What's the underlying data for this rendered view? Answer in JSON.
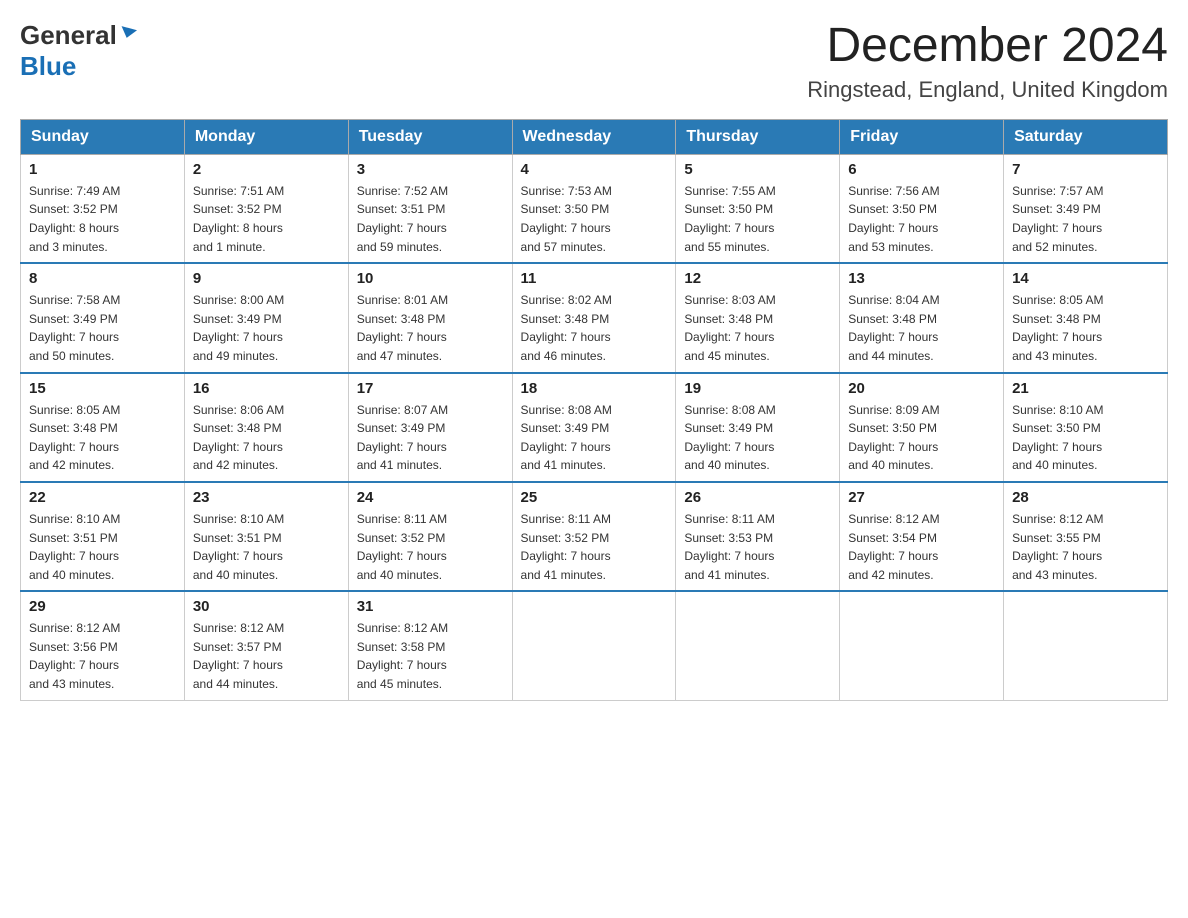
{
  "header": {
    "logo_general": "General",
    "logo_blue": "Blue",
    "month_title": "December 2024",
    "location": "Ringstead, England, United Kingdom"
  },
  "weekdays": [
    "Sunday",
    "Monday",
    "Tuesday",
    "Wednesday",
    "Thursday",
    "Friday",
    "Saturday"
  ],
  "weeks": [
    [
      {
        "day": "1",
        "sunrise": "7:49 AM",
        "sunset": "3:52 PM",
        "daylight": "8 hours and 3 minutes."
      },
      {
        "day": "2",
        "sunrise": "7:51 AM",
        "sunset": "3:52 PM",
        "daylight": "8 hours and 1 minute."
      },
      {
        "day": "3",
        "sunrise": "7:52 AM",
        "sunset": "3:51 PM",
        "daylight": "7 hours and 59 minutes."
      },
      {
        "day": "4",
        "sunrise": "7:53 AM",
        "sunset": "3:50 PM",
        "daylight": "7 hours and 57 minutes."
      },
      {
        "day": "5",
        "sunrise": "7:55 AM",
        "sunset": "3:50 PM",
        "daylight": "7 hours and 55 minutes."
      },
      {
        "day": "6",
        "sunrise": "7:56 AM",
        "sunset": "3:50 PM",
        "daylight": "7 hours and 53 minutes."
      },
      {
        "day": "7",
        "sunrise": "7:57 AM",
        "sunset": "3:49 PM",
        "daylight": "7 hours and 52 minutes."
      }
    ],
    [
      {
        "day": "8",
        "sunrise": "7:58 AM",
        "sunset": "3:49 PM",
        "daylight": "7 hours and 50 minutes."
      },
      {
        "day": "9",
        "sunrise": "8:00 AM",
        "sunset": "3:49 PM",
        "daylight": "7 hours and 49 minutes."
      },
      {
        "day": "10",
        "sunrise": "8:01 AM",
        "sunset": "3:48 PM",
        "daylight": "7 hours and 47 minutes."
      },
      {
        "day": "11",
        "sunrise": "8:02 AM",
        "sunset": "3:48 PM",
        "daylight": "7 hours and 46 minutes."
      },
      {
        "day": "12",
        "sunrise": "8:03 AM",
        "sunset": "3:48 PM",
        "daylight": "7 hours and 45 minutes."
      },
      {
        "day": "13",
        "sunrise": "8:04 AM",
        "sunset": "3:48 PM",
        "daylight": "7 hours and 44 minutes."
      },
      {
        "day": "14",
        "sunrise": "8:05 AM",
        "sunset": "3:48 PM",
        "daylight": "7 hours and 43 minutes."
      }
    ],
    [
      {
        "day": "15",
        "sunrise": "8:05 AM",
        "sunset": "3:48 PM",
        "daylight": "7 hours and 42 minutes."
      },
      {
        "day": "16",
        "sunrise": "8:06 AM",
        "sunset": "3:48 PM",
        "daylight": "7 hours and 42 minutes."
      },
      {
        "day": "17",
        "sunrise": "8:07 AM",
        "sunset": "3:49 PM",
        "daylight": "7 hours and 41 minutes."
      },
      {
        "day": "18",
        "sunrise": "8:08 AM",
        "sunset": "3:49 PM",
        "daylight": "7 hours and 41 minutes."
      },
      {
        "day": "19",
        "sunrise": "8:08 AM",
        "sunset": "3:49 PM",
        "daylight": "7 hours and 40 minutes."
      },
      {
        "day": "20",
        "sunrise": "8:09 AM",
        "sunset": "3:50 PM",
        "daylight": "7 hours and 40 minutes."
      },
      {
        "day": "21",
        "sunrise": "8:10 AM",
        "sunset": "3:50 PM",
        "daylight": "7 hours and 40 minutes."
      }
    ],
    [
      {
        "day": "22",
        "sunrise": "8:10 AM",
        "sunset": "3:51 PM",
        "daylight": "7 hours and 40 minutes."
      },
      {
        "day": "23",
        "sunrise": "8:10 AM",
        "sunset": "3:51 PM",
        "daylight": "7 hours and 40 minutes."
      },
      {
        "day": "24",
        "sunrise": "8:11 AM",
        "sunset": "3:52 PM",
        "daylight": "7 hours and 40 minutes."
      },
      {
        "day": "25",
        "sunrise": "8:11 AM",
        "sunset": "3:52 PM",
        "daylight": "7 hours and 41 minutes."
      },
      {
        "day": "26",
        "sunrise": "8:11 AM",
        "sunset": "3:53 PM",
        "daylight": "7 hours and 41 minutes."
      },
      {
        "day": "27",
        "sunrise": "8:12 AM",
        "sunset": "3:54 PM",
        "daylight": "7 hours and 42 minutes."
      },
      {
        "day": "28",
        "sunrise": "8:12 AM",
        "sunset": "3:55 PM",
        "daylight": "7 hours and 43 minutes."
      }
    ],
    [
      {
        "day": "29",
        "sunrise": "8:12 AM",
        "sunset": "3:56 PM",
        "daylight": "7 hours and 43 minutes."
      },
      {
        "day": "30",
        "sunrise": "8:12 AM",
        "sunset": "3:57 PM",
        "daylight": "7 hours and 44 minutes."
      },
      {
        "day": "31",
        "sunrise": "8:12 AM",
        "sunset": "3:58 PM",
        "daylight": "7 hours and 45 minutes."
      },
      null,
      null,
      null,
      null
    ]
  ],
  "labels": {
    "sunrise": "Sunrise:",
    "sunset": "Sunset:",
    "daylight": "Daylight:"
  }
}
